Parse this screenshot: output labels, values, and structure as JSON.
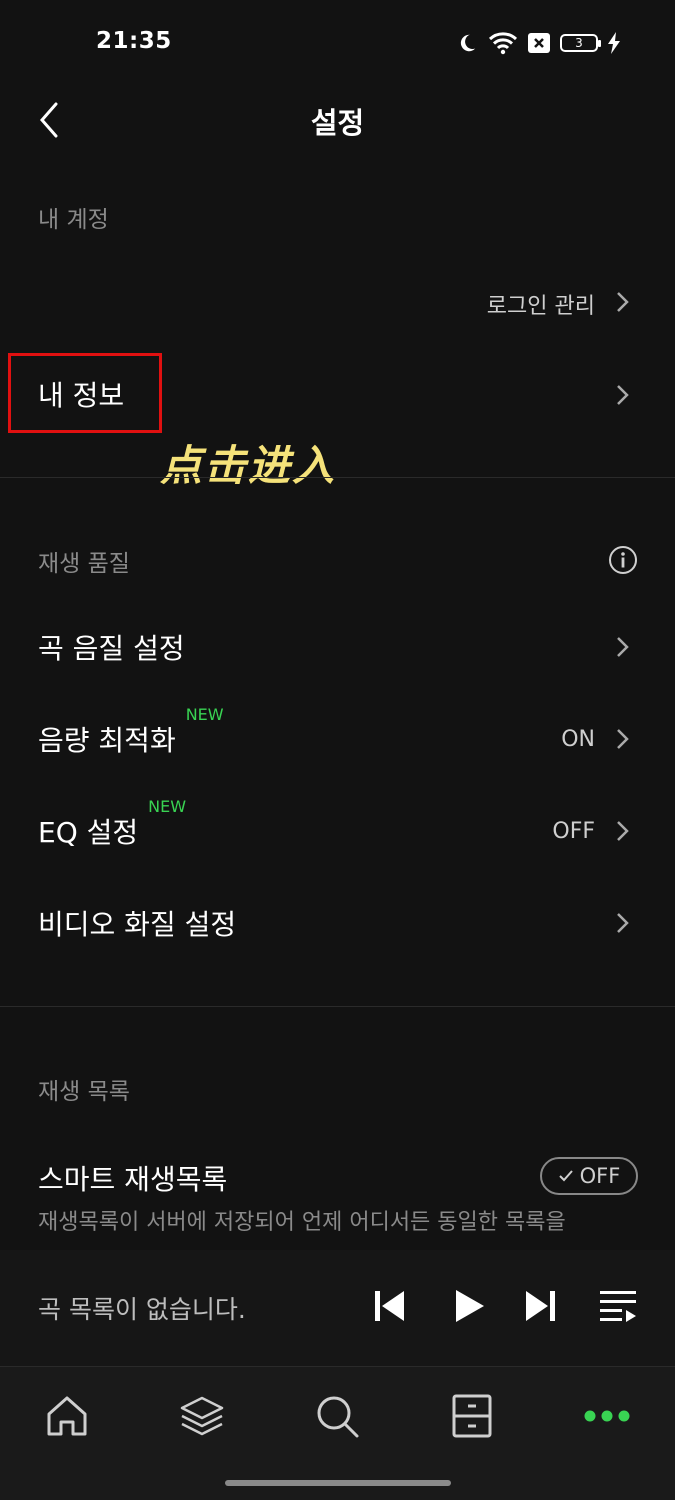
{
  "status": {
    "time": "21:35",
    "battery": "3"
  },
  "header": {
    "title": "설정"
  },
  "account": {
    "section_label": "내 계정",
    "login_manage": "로그인 관리",
    "my_info": "내 정보"
  },
  "annotation": {
    "text": "点击进入"
  },
  "quality": {
    "section_label": "재생 품질",
    "items": [
      {
        "label": "곡 음질 설정",
        "badge": "",
        "value": ""
      },
      {
        "label": "음량 최적화",
        "badge": "NEW",
        "value": "ON"
      },
      {
        "label": "EQ 설정",
        "badge": "NEW",
        "value": "OFF"
      },
      {
        "label": "비디오 화질 설정",
        "badge": "",
        "value": ""
      }
    ]
  },
  "playlist": {
    "section_label": "재생 목록",
    "smart_label": "스마트 재생목록",
    "smart_toggle": "OFF",
    "smart_desc": "재생목록이 서버에 저장되어 언제 어디서든 동일한 목록을"
  },
  "player": {
    "empty_text": "곡 목록이 없습니다."
  },
  "colors": {
    "background": "#121212",
    "accent": "#39d353",
    "highlight": "#e01010",
    "annotation": "#f5e27a"
  },
  "icons": [
    "back-icon",
    "moon-icon",
    "wifi-icon",
    "sim-icon",
    "battery-icon",
    "charging-icon",
    "chevron-right-icon",
    "info-icon",
    "check-icon",
    "skip-previous-icon",
    "play-icon",
    "skip-next-icon",
    "queue-icon",
    "home-icon",
    "layers-icon",
    "search-icon",
    "cabinet-icon",
    "more-icon"
  ]
}
